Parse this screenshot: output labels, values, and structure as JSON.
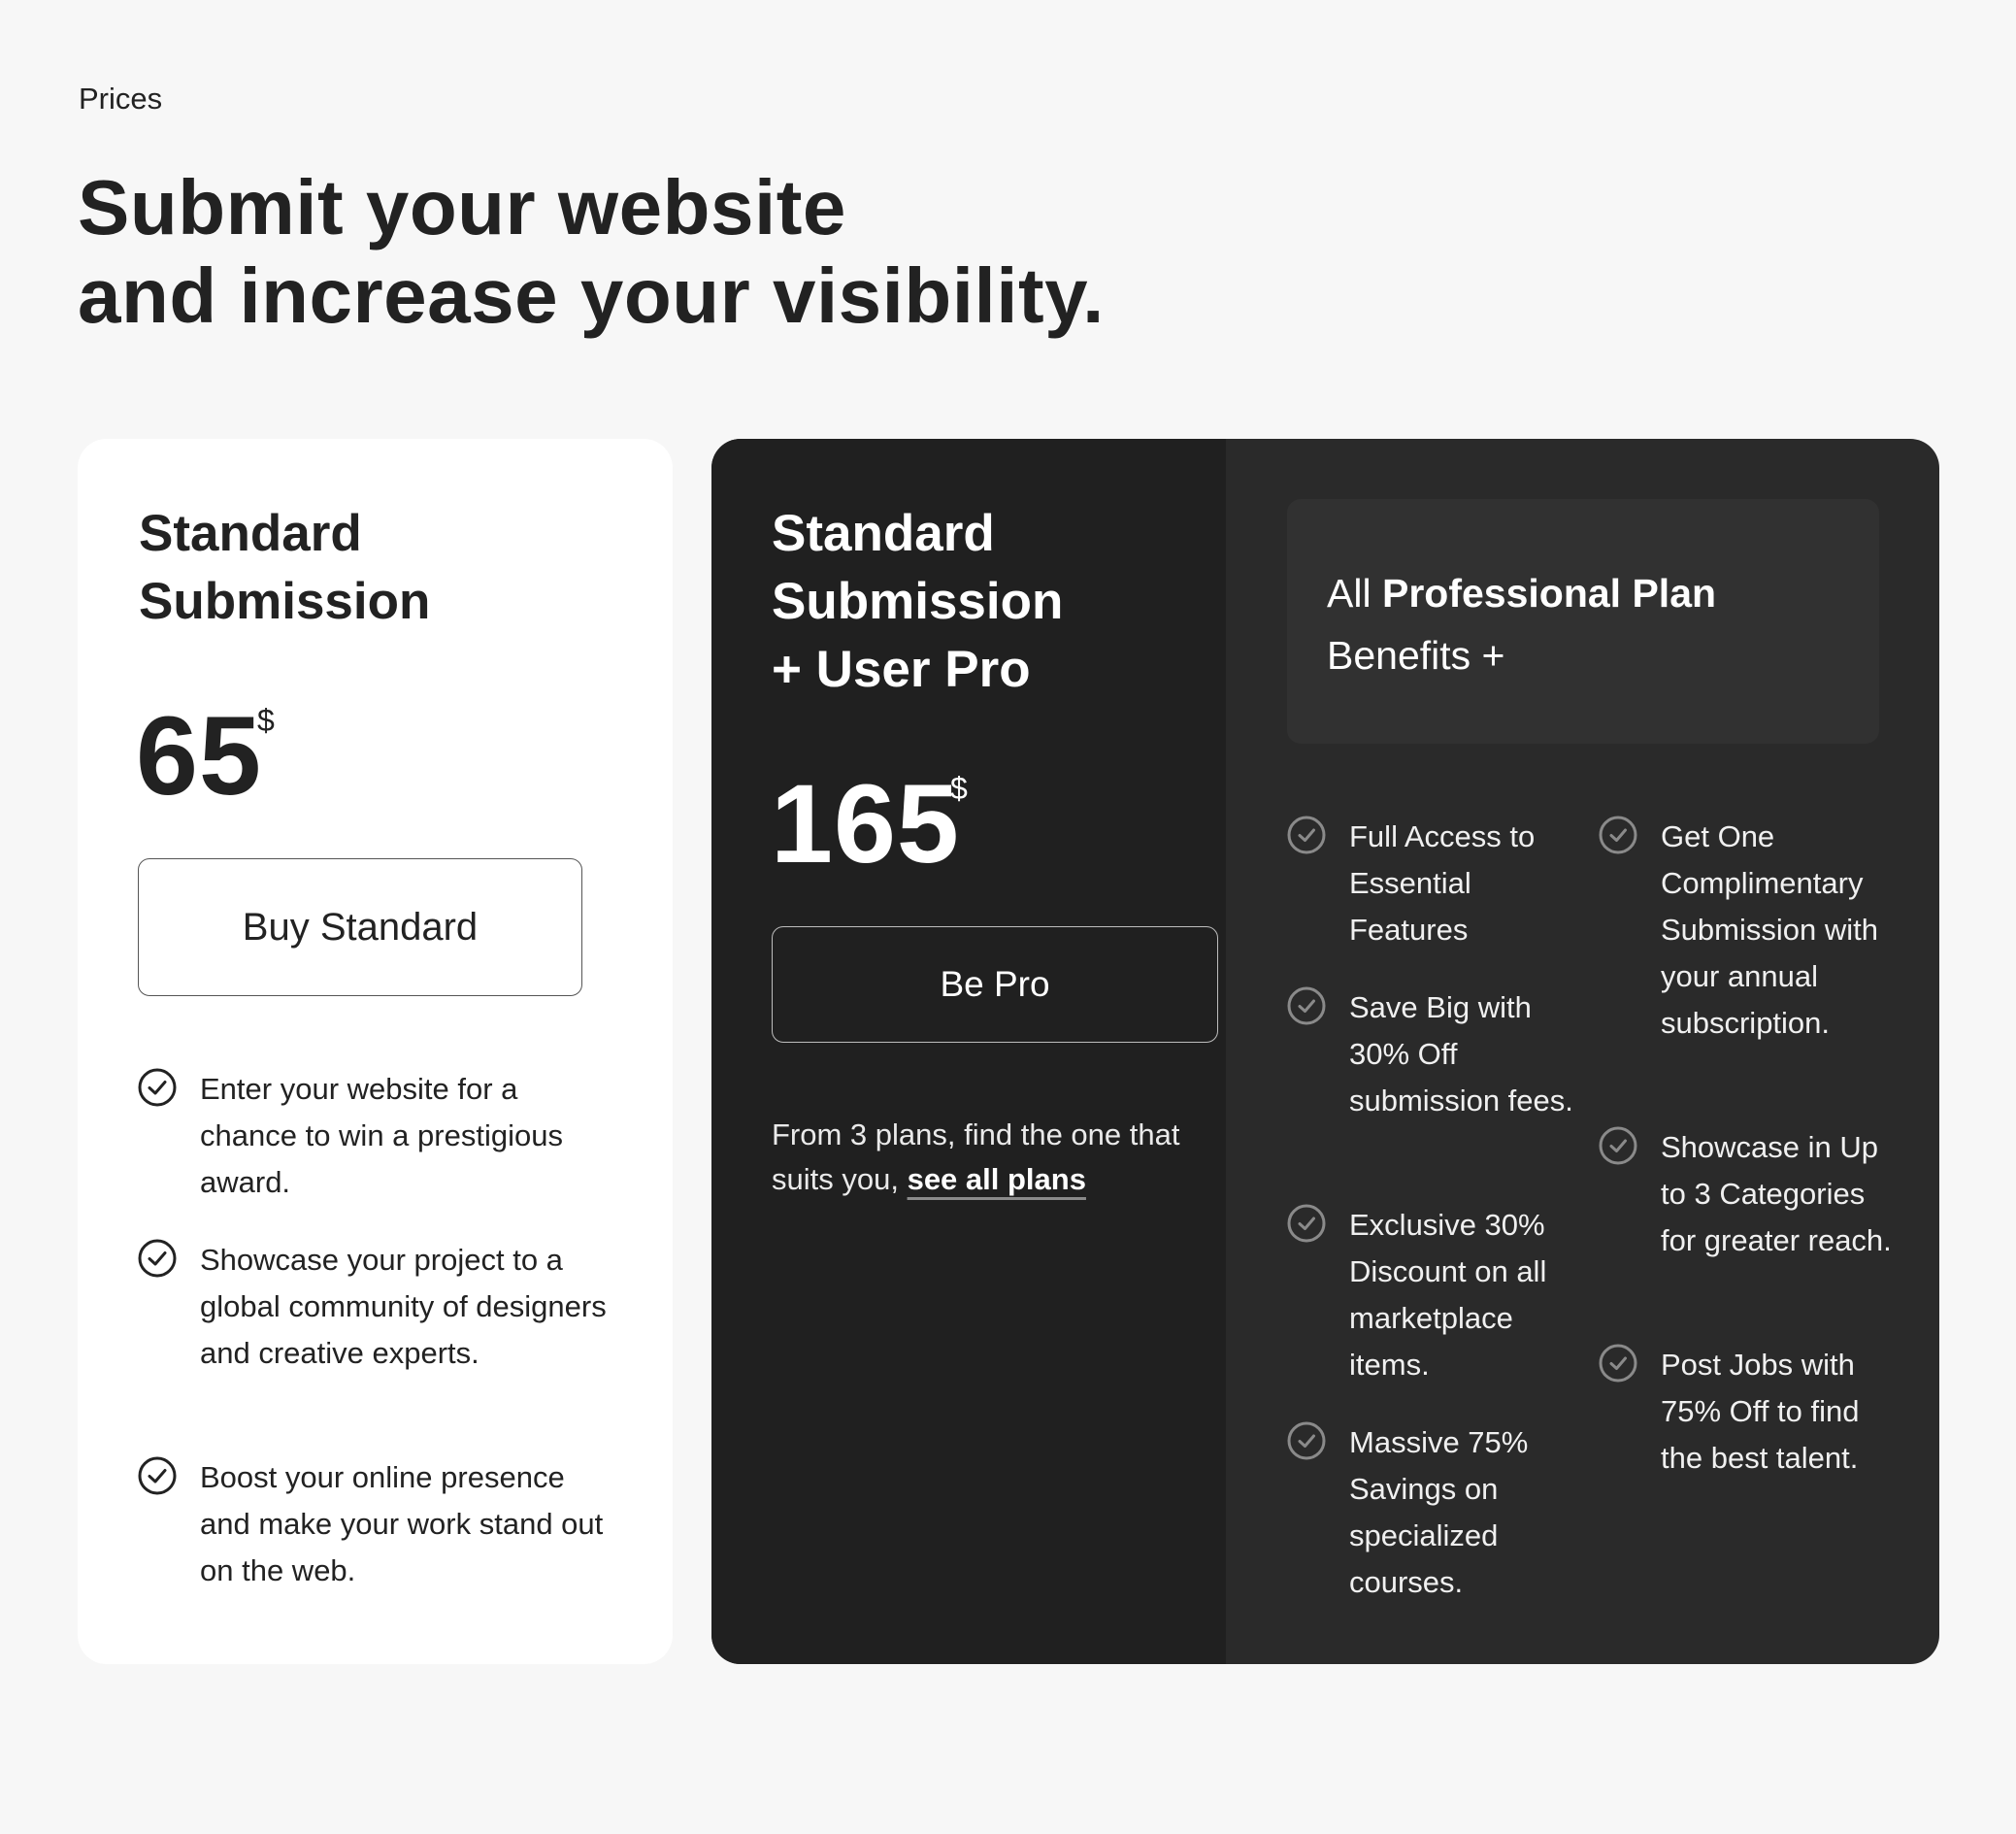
{
  "section": {
    "eyebrow": "Prices",
    "headline_line1": "Submit your website",
    "headline_line2": "and increase your visibility."
  },
  "standard_plan": {
    "title_line1": "Standard",
    "title_line2": "Submission",
    "price": "65",
    "currency": "$",
    "button_label": "Buy Standard",
    "features": [
      "Enter your website for a chance to win a prestigious award.",
      "Showcase your project to a global community of designers and creative experts.",
      "Boost your online presence and make your work stand out on the web."
    ]
  },
  "pro_plan": {
    "title_line1": "Standard",
    "title_line2": "Submission",
    "title_line3": "+ User Pro",
    "price": "165",
    "currency": "$",
    "button_label": "Be Pro",
    "note_text": "From 3 plans, find the one that suits you,",
    "note_link": "see all plans",
    "benefits_prefix": "All",
    "benefits_bold": "Professional Plan",
    "benefits_suffix": "Benefits +",
    "features_col1": [
      "Full Access to Essential Features",
      "Save Big with 30% Off submission fees.",
      "Exclusive 30% Discount on all marketplace items.",
      "Massive 75% Savings on specialized courses."
    ],
    "features_col2": [
      "Get One Complimentary Submission with your annual subscription.",
      "Showcase in Up to 3 Categories for greater reach.",
      "Post Jobs with 75% Off to find the best talent."
    ]
  },
  "colors": {
    "page_bg": "#f7f7f7",
    "text_dark": "#222222",
    "pro_dark": "#202020",
    "pro_panel": "#2a2a2a"
  },
  "icons": {
    "feature_check": "check-circle-icon"
  }
}
